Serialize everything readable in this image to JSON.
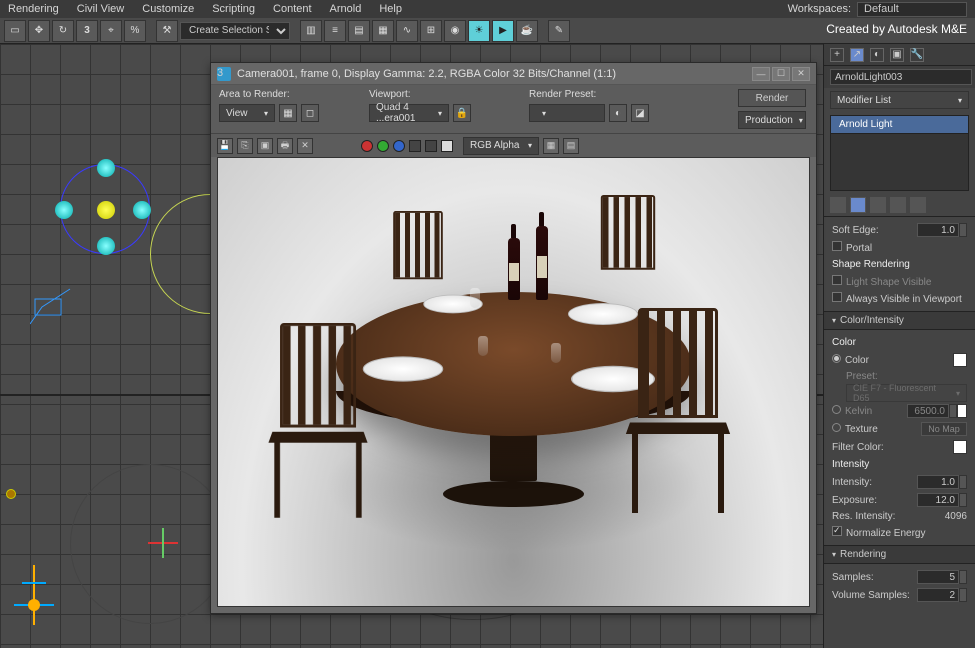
{
  "menu": {
    "items": [
      "Rendering",
      "Civil View",
      "Customize",
      "Scripting",
      "Content",
      "Arnold",
      "Help"
    ]
  },
  "workspace": {
    "label": "Workspaces:",
    "value": "Default"
  },
  "created_by": "Created by Autodesk M&E",
  "toolbar": {
    "selection_set": "Create Selection Se"
  },
  "render_window": {
    "title": "Camera001, frame 0, Display Gamma: 2.2, RGBA Color 32 Bits/Channel (1:1)",
    "area_to_render_label": "Area to Render:",
    "area_to_render_value": "View",
    "viewport_label": "Viewport:",
    "viewport_value": "Quad 4 ...era001",
    "render_preset_label": "Render Preset:",
    "render_preset_value": "",
    "render_btn": "Render",
    "production_value": "Production",
    "channel_value": "RGB Alpha"
  },
  "right": {
    "object_name": "ArnoldLight003",
    "modifier_list_label": "Modifier List",
    "stack_item": "Arnold Light",
    "soft_edge_label": "Soft Edge:",
    "soft_edge_value": "1.0",
    "portal_label": "Portal",
    "shape_rendering_label": "Shape Rendering",
    "light_shape_visible": "Light Shape Visible",
    "always_visible": "Always Visible in Viewport",
    "color_intensity_header": "Color/Intensity",
    "color_label": "Color",
    "color_radio": "Color",
    "preset_label": "Preset:",
    "preset_value": "CIE F7 - Fluorescent D65",
    "kelvin_label": "Kelvin",
    "kelvin_value": "6500.0",
    "texture_label": "Texture",
    "nomap": "No Map",
    "filter_color_label": "Filter Color:",
    "intensity_hd": "Intensity",
    "intensity_label": "Intensity:",
    "intensity_value": "1.0",
    "exposure_label": "Exposure:",
    "exposure_value": "12.0",
    "res_intensity_label": "Res. Intensity:",
    "res_intensity_value": "4096",
    "normalize_label": "Normalize Energy",
    "rendering_header": "Rendering",
    "samples_label": "Samples:",
    "samples_value": "5",
    "vol_samples_label": "Volume Samples:",
    "vol_samples_value": "2"
  }
}
